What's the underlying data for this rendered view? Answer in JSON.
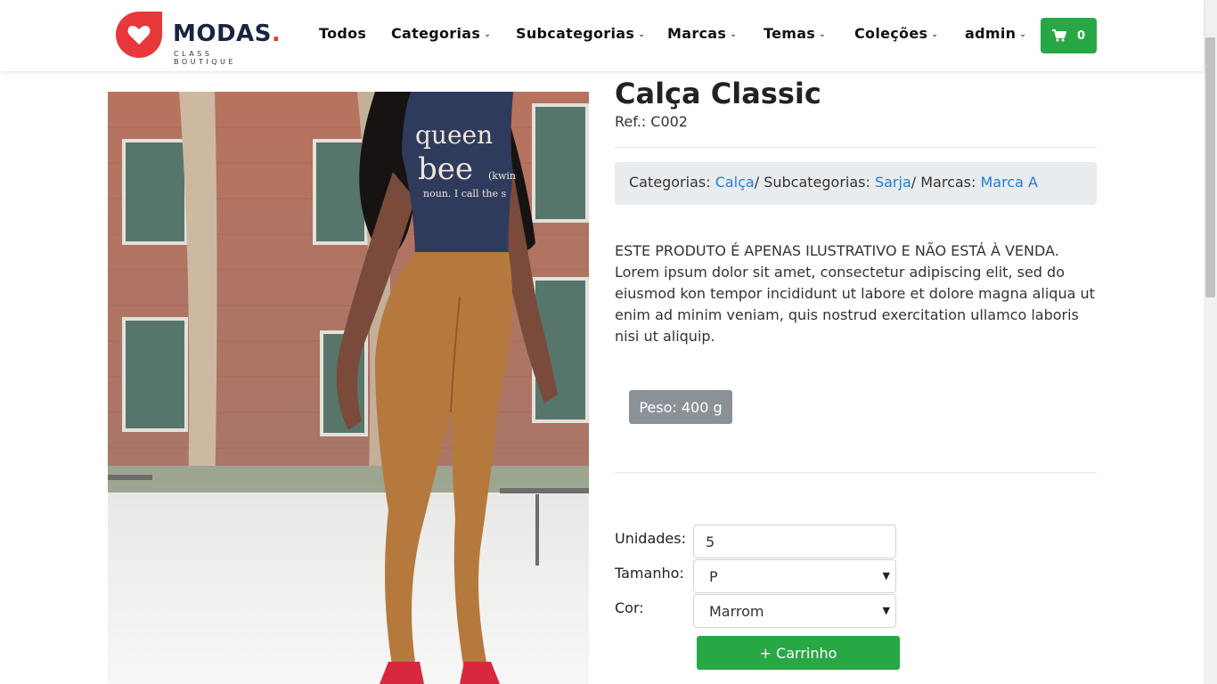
{
  "brand": {
    "name": "MODAS",
    "name_dot": ".",
    "tagline": "CLASS BOUTIQUE",
    "accent_color": "#e8383b",
    "icon": "heart-icon"
  },
  "nav": {
    "items": [
      {
        "label": "Todos",
        "has_dropdown": false
      },
      {
        "label": "Categorias",
        "has_dropdown": true
      },
      {
        "label": "Subcategorias",
        "has_dropdown": true
      },
      {
        "label": "Marcas",
        "has_dropdown": true
      },
      {
        "label": "Temas",
        "has_dropdown": true
      },
      {
        "label": "Coleções",
        "has_dropdown": true
      },
      {
        "label": "admin",
        "has_dropdown": true
      }
    ],
    "chevron": "⌄",
    "cart_count": "0",
    "cart_icon": "shopping-cart-icon",
    "cart_color": "#28a745"
  },
  "product": {
    "title": "Calça Classic",
    "ref": "Ref.: C002",
    "categories_label": "Categorias: ",
    "category": "Calça",
    "subcategories_label": "/ Subcategorias: ",
    "subcategory": "Sarja",
    "brands_label": "/ Marcas: ",
    "brand": "Marca A",
    "description": "ESTE PRODUTO É APENAS ILUSTRATIVO E NÃO ESTÁ À VENDA. Lorem ipsum dolor sit amet, consectetur adipiscing elit, sed do eiusmod kon tempor incididunt ut labore et dolore magna aliqua ut enim ad minim veniam, quis nostrud exercitation ullamco laboris nisi ut aliquip.",
    "weight": "Peso: 400 g",
    "image_shirt_text_1": "queen",
    "image_shirt_text_2": "bee",
    "image_shirt_text_3": "(kwin",
    "image_shirt_text_4": "noun. I call the s"
  },
  "form": {
    "units_label": "Unidades:",
    "units_value": "5",
    "size_label": "Tamanho:",
    "size_value": "P",
    "color_label": "Cor:",
    "color_value": "Marrom",
    "add_button": "+ Carrinho"
  }
}
